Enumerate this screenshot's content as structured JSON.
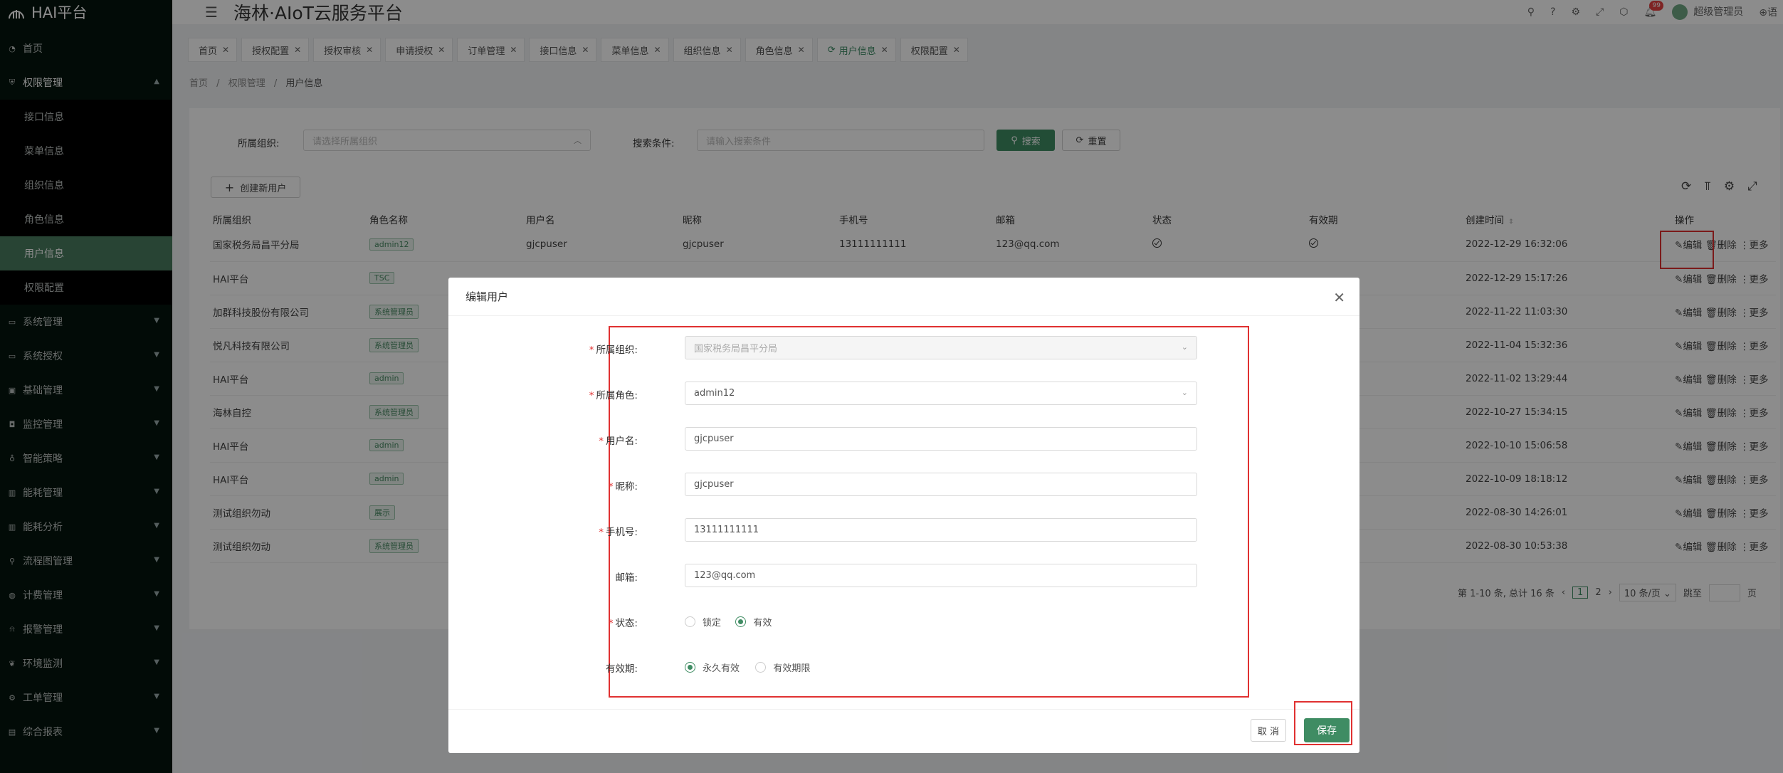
{
  "app": {
    "logo_text": "HAI平台",
    "header_title": "海林·AIoT云服务平台",
    "user_name": "超级管理员",
    "notif_count": "99",
    "trailing": "语"
  },
  "sidebar": {
    "items": [
      {
        "label": "首页",
        "icon": "home-icon"
      },
      {
        "label": "权限管理",
        "icon": "shield-icon",
        "open": true
      },
      {
        "label": "系统管理",
        "icon": "monitor-icon"
      },
      {
        "label": "系统授权",
        "icon": "monitor-icon"
      },
      {
        "label": "基础管理",
        "icon": "box-icon"
      },
      {
        "label": "监控管理",
        "icon": "camera-icon"
      },
      {
        "label": "智能策略",
        "icon": "bulb-icon"
      },
      {
        "label": "能耗管理",
        "icon": "chart-icon"
      },
      {
        "label": "能耗分析",
        "icon": "chart-icon"
      },
      {
        "label": "流程图管理",
        "icon": "flow-icon"
      },
      {
        "label": "计费管理",
        "icon": "coin-icon"
      },
      {
        "label": "报警管理",
        "icon": "alarm-icon"
      },
      {
        "label": "环境监测",
        "icon": "leaf-icon"
      },
      {
        "label": "工单管理",
        "icon": "ticket-icon"
      },
      {
        "label": "综合报表",
        "icon": "report-icon"
      }
    ],
    "submenu": [
      "接口信息",
      "菜单信息",
      "组织信息",
      "角色信息",
      "用户信息",
      "权限配置"
    ]
  },
  "tabs": [
    "首页",
    "授权配置",
    "授权审核",
    "申请授权",
    "订单管理",
    "接口信息",
    "菜单信息",
    "组织信息",
    "角色信息",
    "用户信息",
    "权限配置"
  ],
  "breadcrumb": [
    "首页",
    "权限管理",
    "用户信息"
  ],
  "filter": {
    "org_label": "所属组织:",
    "org_placeholder": "请选择所属组织",
    "search_label": "搜索条件:",
    "search_placeholder": "请输入搜索条件",
    "search_btn": "搜索",
    "reset_btn": "重置"
  },
  "create_btn": "创建新用户",
  "table": {
    "columns": [
      "所属组织",
      "角色名称",
      "用户名",
      "昵称",
      "手机号",
      "邮箱",
      "状态",
      "有效期",
      "创建时间",
      "操作"
    ],
    "rows": [
      {
        "org": "国家税务局昌平分局",
        "role": "admin12",
        "user": "gjcpuser",
        "nick": "gjcpuser",
        "phone": "13111111111",
        "email": "123@qq.com",
        "time": "2022-12-29 16:32:06"
      },
      {
        "org": "HAI平台",
        "role": "TSC",
        "time": "2022-12-29 15:17:26"
      },
      {
        "org": "加群科技股份有限公司",
        "role": "系统管理员",
        "time": "2022-11-22 11:03:30"
      },
      {
        "org": "悦凡科技有限公司",
        "role": "系统管理员",
        "time": "2022-11-04 15:32:36"
      },
      {
        "org": "HAI平台",
        "role": "admin",
        "time": "2022-11-02 13:29:44"
      },
      {
        "org": "海林自控",
        "role": "系统管理员",
        "time": "2022-10-27 15:34:15"
      },
      {
        "org": "HAI平台",
        "role": "admin",
        "time": "2022-10-10 15:06:58"
      },
      {
        "org": "HAI平台",
        "role": "admin",
        "time": "2022-10-09 18:18:12"
      },
      {
        "org": "测试组织勿动",
        "role": "展示",
        "time": "2022-08-30 14:26:01"
      },
      {
        "org": "测试组织勿动",
        "role": "系统管理员",
        "time": "2022-08-30 10:53:38"
      }
    ],
    "ops": {
      "edit": "编辑",
      "delete": "删除",
      "more": "更多"
    }
  },
  "pagination": {
    "summary": "第 1-10 条, 总计 16 条",
    "pages": [
      "1",
      "2"
    ],
    "page_size": "10 条/页",
    "jump_label": "跳至",
    "page_unit": "页"
  },
  "modal": {
    "title": "编辑用户",
    "fields": {
      "org": {
        "label": "所属组织:",
        "value": "国家税务局昌平分局"
      },
      "role": {
        "label": "所属角色:",
        "value": "admin12"
      },
      "username": {
        "label": "用户名:",
        "value": "gjcpuser"
      },
      "nickname": {
        "label": "昵称:",
        "value": "gjcpuser"
      },
      "phone": {
        "label": "手机号:",
        "value": "13111111111"
      },
      "email": {
        "label": "邮箱:",
        "value": "123@qq.com"
      },
      "status": {
        "label": "状态:",
        "options": [
          "锁定",
          "有效"
        ],
        "selected": "有效"
      },
      "validity": {
        "label": "有效期:",
        "options": [
          "永久有效",
          "有效期限"
        ],
        "selected": "永久有效"
      }
    },
    "cancel": "取 消",
    "save": "保存"
  },
  "colors": {
    "accent": "#3f8c63",
    "sidebar_bg": "#04150e",
    "highlight": "#e03131"
  }
}
